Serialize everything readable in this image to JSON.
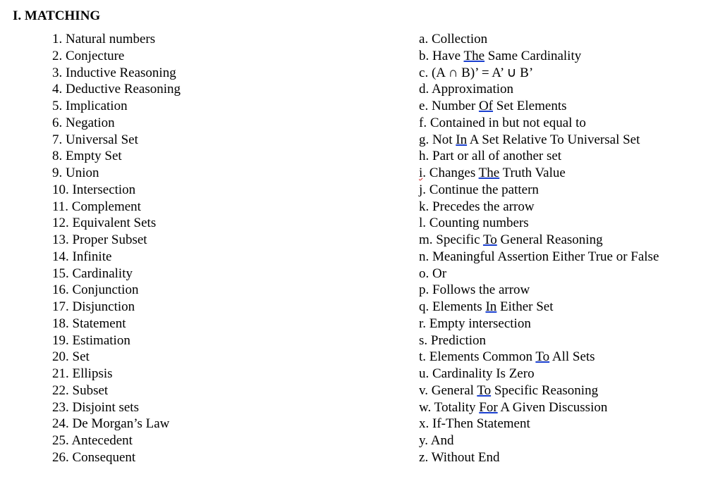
{
  "heading": "I. MATCHING",
  "left": [
    {
      "n": "1",
      "t": "Natural numbers"
    },
    {
      "n": "2",
      "t": "Conjecture"
    },
    {
      "n": "3",
      "t": "Inductive Reasoning"
    },
    {
      "n": "4",
      "t": "Deductive Reasoning"
    },
    {
      "n": "5",
      "t": "Implication"
    },
    {
      "n": "6",
      "t": "Negation"
    },
    {
      "n": "7",
      "t": "Universal Set"
    },
    {
      "n": "8",
      "t": "Empty Set"
    },
    {
      "n": "9",
      "t": "Union"
    },
    {
      "n": "10",
      "t": "Intersection"
    },
    {
      "n": "11",
      "t": "Complement"
    },
    {
      "n": "12",
      "t": "Equivalent Sets"
    },
    {
      "n": "13",
      "t": "Proper Subset"
    },
    {
      "n": "14",
      "t": "Infinite"
    },
    {
      "n": "15",
      "t": "Cardinality"
    },
    {
      "n": "16",
      "t": "Conjunction"
    },
    {
      "n": "17",
      "t": "Disjunction"
    },
    {
      "n": "18",
      "t": "Statement"
    },
    {
      "n": "19",
      "t": "Estimation"
    },
    {
      "n": "20",
      "t": "Set"
    },
    {
      "n": "21",
      "t": "Ellipsis"
    },
    {
      "n": "22",
      "t": "Subset"
    },
    {
      "n": "23",
      "t": "Disjoint sets"
    },
    {
      "n": "24",
      "t": "De Morgan’s Law"
    },
    {
      "n": "25",
      "t": "Antecedent"
    },
    {
      "n": "26",
      "t": "Consequent"
    }
  ],
  "right": [
    {
      "n": "a",
      "parts": [
        {
          "s": "Collection"
        }
      ]
    },
    {
      "n": "b",
      "parts": [
        {
          "s": "Have "
        },
        {
          "s": "The",
          "u": true
        },
        {
          "s": " Same Cardinality"
        }
      ]
    },
    {
      "n": "c",
      "parts": [
        {
          "s": "(A ∩ B)’ = A’ ∪ B’"
        }
      ]
    },
    {
      "n": "d",
      "parts": [
        {
          "s": "Approximation"
        }
      ]
    },
    {
      "n": "e",
      "parts": [
        {
          "s": "Number "
        },
        {
          "s": "Of",
          "u": true
        },
        {
          "s": " Set Elements"
        }
      ]
    },
    {
      "n": "f",
      "parts": [
        {
          "s": "Contained in but not equal to"
        }
      ]
    },
    {
      "n": "g",
      "parts": [
        {
          "s": "Not "
        },
        {
          "s": "In",
          "u": true
        },
        {
          "s": " A Set Relative To Universal Set"
        }
      ]
    },
    {
      "n": "h",
      "parts": [
        {
          "s": "Part or all of another set"
        }
      ]
    },
    {
      "n": "i",
      "sq": true,
      "parts": [
        {
          "s": "Changes "
        },
        {
          "s": "The",
          "u": true
        },
        {
          "s": " Truth Value"
        }
      ]
    },
    {
      "n": "j",
      "parts": [
        {
          "s": "Continue the pattern"
        }
      ]
    },
    {
      "n": "k",
      "parts": [
        {
          "s": "Precedes the arrow"
        }
      ]
    },
    {
      "n": "l",
      "parts": [
        {
          "s": "Counting numbers"
        }
      ]
    },
    {
      "n": "m",
      "parts": [
        {
          "s": "Specific "
        },
        {
          "s": "To",
          "u": true
        },
        {
          "s": " General Reasoning"
        }
      ]
    },
    {
      "n": "n",
      "parts": [
        {
          "s": "Meaningful Assertion Either True or False"
        }
      ]
    },
    {
      "n": "o",
      "parts": [
        {
          "s": "Or"
        }
      ]
    },
    {
      "n": "p",
      "parts": [
        {
          "s": "Follows the arrow"
        }
      ]
    },
    {
      "n": "q",
      "parts": [
        {
          "s": "Elements "
        },
        {
          "s": "In",
          "u": true
        },
        {
          "s": " Either Set"
        }
      ]
    },
    {
      "n": "r",
      "parts": [
        {
          "s": "Empty intersection"
        }
      ]
    },
    {
      "n": "s",
      "parts": [
        {
          "s": "Prediction"
        }
      ]
    },
    {
      "n": "t",
      "parts": [
        {
          "s": "Elements Common "
        },
        {
          "s": "To",
          "u": true
        },
        {
          "s": " All Sets"
        }
      ]
    },
    {
      "n": "u",
      "parts": [
        {
          "s": "Cardinality Is Zero"
        }
      ]
    },
    {
      "n": "v",
      "parts": [
        {
          "s": "General "
        },
        {
          "s": "To",
          "u": true
        },
        {
          "s": " Specific Reasoning"
        }
      ]
    },
    {
      "n": "w",
      "parts": [
        {
          "s": "Totality "
        },
        {
          "s": "For",
          "u": true
        },
        {
          "s": " A Given Discussion"
        }
      ]
    },
    {
      "n": "x",
      "parts": [
        {
          "s": "If-Then Statement"
        }
      ]
    },
    {
      "n": "y",
      "parts": [
        {
          "s": "And"
        }
      ]
    },
    {
      "n": "z",
      "parts": [
        {
          "s": "Without End"
        }
      ]
    }
  ]
}
